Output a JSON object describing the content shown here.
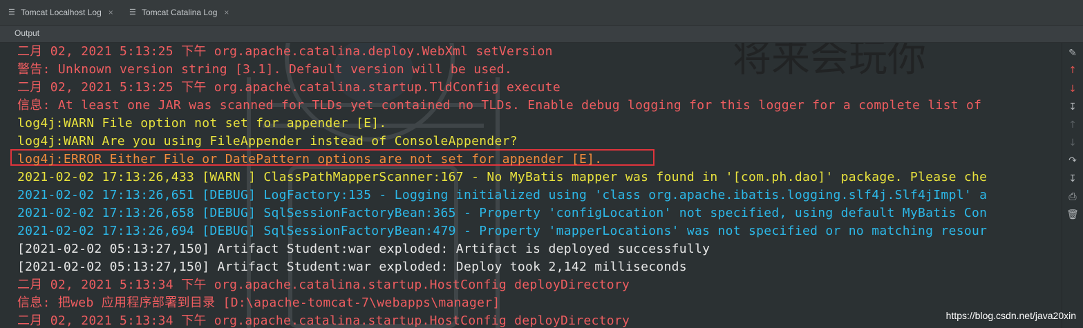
{
  "tabs": [
    {
      "label": "Tomcat Localhost Log",
      "close": "×"
    },
    {
      "label": "Tomcat Catalina Log",
      "close": "×"
    }
  ],
  "output_label": "Output",
  "background_art_text": "将来会玩你",
  "log_lines": [
    {
      "text": "二月 02, 2021 5:13:25 下午 org.apache.catalina.deploy.WebXml setVersion",
      "color": "#ef5d60"
    },
    {
      "text": "警告: Unknown version string [3.1]. Default version will be used.",
      "color": "#ef5d60"
    },
    {
      "text": "二月 02, 2021 5:13:25 下午 org.apache.catalina.startup.TldConfig execute",
      "color": "#ef5d60"
    },
    {
      "text": "信息: At least one JAR was scanned for TLDs yet contained no TLDs. Enable debug logging for this logger for a complete list of",
      "color": "#ef5d60"
    },
    {
      "text": "log4j:WARN File option not set for appender [E].",
      "color": "#e8e23d"
    },
    {
      "text": "log4j:WARN Are you using FileAppender instead of ConsoleAppender?",
      "color": "#e8e23d"
    },
    {
      "text": "log4j:ERROR Either File or DatePattern options are not set for appender [E].",
      "color": "#f08a3c"
    },
    {
      "text": "2021-02-02 17:13:26,433 [WARN ] ClassPathMapperScanner:167 - No MyBatis mapper was found in '[com.ph.dao]' package. Please che",
      "color": "#e8e23d"
    },
    {
      "text": "2021-02-02 17:13:26,651 [DEBUG] LogFactory:135 - Logging initialized using 'class org.apache.ibatis.logging.slf4j.Slf4jImpl' a",
      "color": "#2cb8e8"
    },
    {
      "text": "2021-02-02 17:13:26,658 [DEBUG] SqlSessionFactoryBean:365 - Property 'configLocation' not specified, using default MyBatis Con",
      "color": "#2cb8e8"
    },
    {
      "text": "2021-02-02 17:13:26,694 [DEBUG] SqlSessionFactoryBean:479 - Property 'mapperLocations' was not specified or no matching resour",
      "color": "#2cb8e8"
    },
    {
      "text": "[2021-02-02 05:13:27,150] Artifact Student:war exploded: Artifact is deployed successfully",
      "color": "#e6e6e6"
    },
    {
      "text": "[2021-02-02 05:13:27,150] Artifact Student:war exploded: Deploy took 2,142 milliseconds",
      "color": "#e6e6e6"
    },
    {
      "text": "二月 02, 2021 5:13:34 下午 org.apache.catalina.startup.HostConfig deployDirectory",
      "color": "#ef5d60"
    },
    {
      "text": "信息: 把web 应用程序部署到目录 [D:\\apache-tomcat-7\\webapps\\manager]",
      "color": "#ef5d60"
    },
    {
      "text": "二月 02, 2021 5:13:34 下午 org.apache.catalina.startup.HostConfig deployDirectory",
      "color": "#ef5d60"
    }
  ],
  "highlight_color": "#e0343c",
  "toolbar_icons": [
    "clear-all-icon",
    "up-arrow-icon",
    "down-arrow-icon",
    "scroll-to-end-icon",
    "up-stack-icon",
    "down-stack-icon",
    "soft-wrap-icon",
    "scroll-to-end-alt-icon",
    "print-icon",
    "delete-icon"
  ],
  "watermark": "https://blog.csdn.net/java20xin"
}
